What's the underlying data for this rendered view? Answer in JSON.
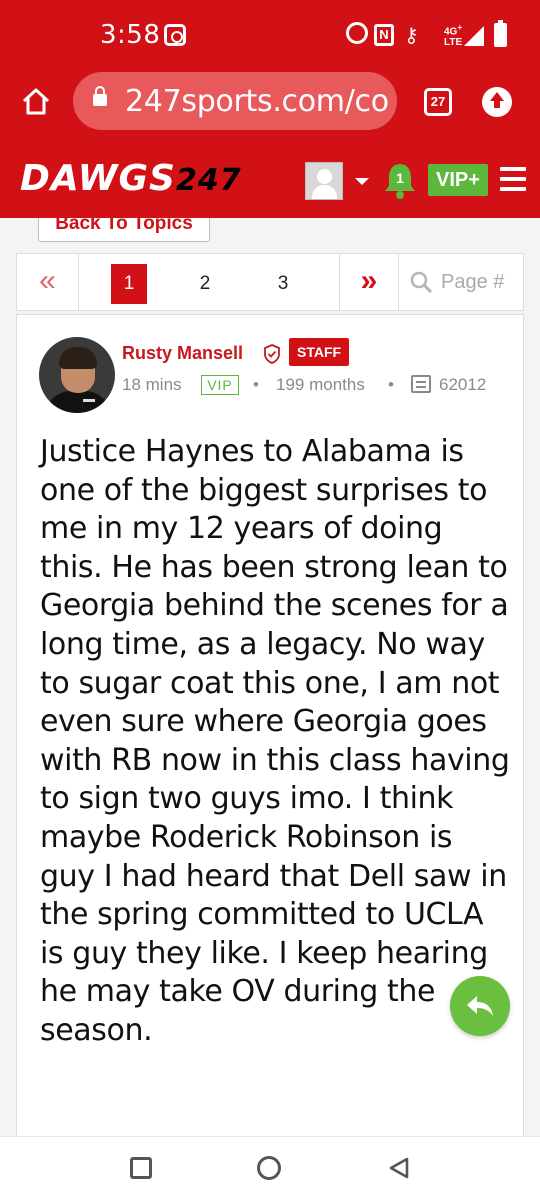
{
  "status": {
    "time": "3:58",
    "network": "4G+\nLTE"
  },
  "browser": {
    "url": "247sports.com/co",
    "tab_count": "27"
  },
  "header": {
    "logo_main": "DAWGS",
    "logo_num": "247",
    "notification_count": "1",
    "vip_label": "VIP+"
  },
  "nav": {
    "back_label": "Back To Topics"
  },
  "pagination": {
    "prev": "«",
    "next": "»",
    "pages": [
      "1",
      "2",
      "3"
    ],
    "current": "1",
    "search_placeholder": "Page #"
  },
  "post": {
    "author": "Rusty Mansell",
    "badge": "STAFF",
    "time": "18 mins",
    "vip_tag": "VIP",
    "tenure": "199 months",
    "post_count": "62012",
    "body": "Justice Haynes to Alabama is one of the biggest surprises to me in my 12 years of doing this. He has been strong lean to Georgia behind the scenes for a long time, as a legacy. No way to sugar coat this one, I am not even sure where Georgia goes with RB now in this class having to sign two guys imo. I think maybe Roderick Robinson is guy I had heard that Dell saw in the spring committed to UCLA is guy they like. I keep hearing he may take OV during the season."
  },
  "colors": {
    "brand_red": "#d21116",
    "vip_green": "#5cb83c",
    "fab_green": "#6abf40"
  }
}
